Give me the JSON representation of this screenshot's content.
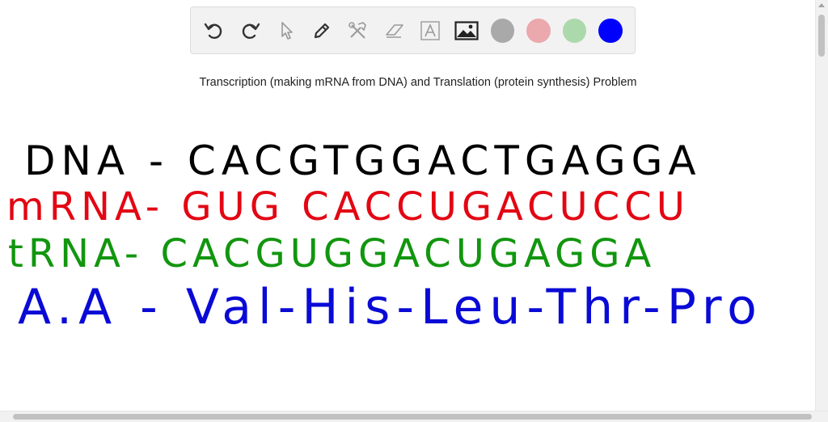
{
  "toolbar": {
    "tools": [
      {
        "icon": "undo-icon"
      },
      {
        "icon": "redo-icon"
      },
      {
        "icon": "select-pointer-icon"
      },
      {
        "icon": "pen-icon"
      },
      {
        "icon": "tools-icon"
      },
      {
        "icon": "eraser-icon"
      },
      {
        "icon": "text-icon",
        "glyph": "A"
      },
      {
        "icon": "image-icon"
      }
    ],
    "colors": {
      "gray": "#a9a9a9",
      "pink": "#eba8ad",
      "green": "#acd9ac",
      "blue": "#0000ff"
    }
  },
  "canvas": {
    "title": "Transcription (making mRNA from DNA) and Translation (protein synthesis) Problem",
    "lines": {
      "dna": "DNA - CACGTGGACTGAGGA",
      "mrna": "mRNA- GUG CACCUGACUCCU",
      "trna": "tRNA- CACGUGGACUGAGGA",
      "aa": "A.A - Val-His-Leu-Thr-Pro"
    },
    "ink_colors": {
      "dna": "#000000",
      "mrna": "#e30613",
      "trna": "#12960f",
      "aa": "#0a0ad6"
    }
  }
}
